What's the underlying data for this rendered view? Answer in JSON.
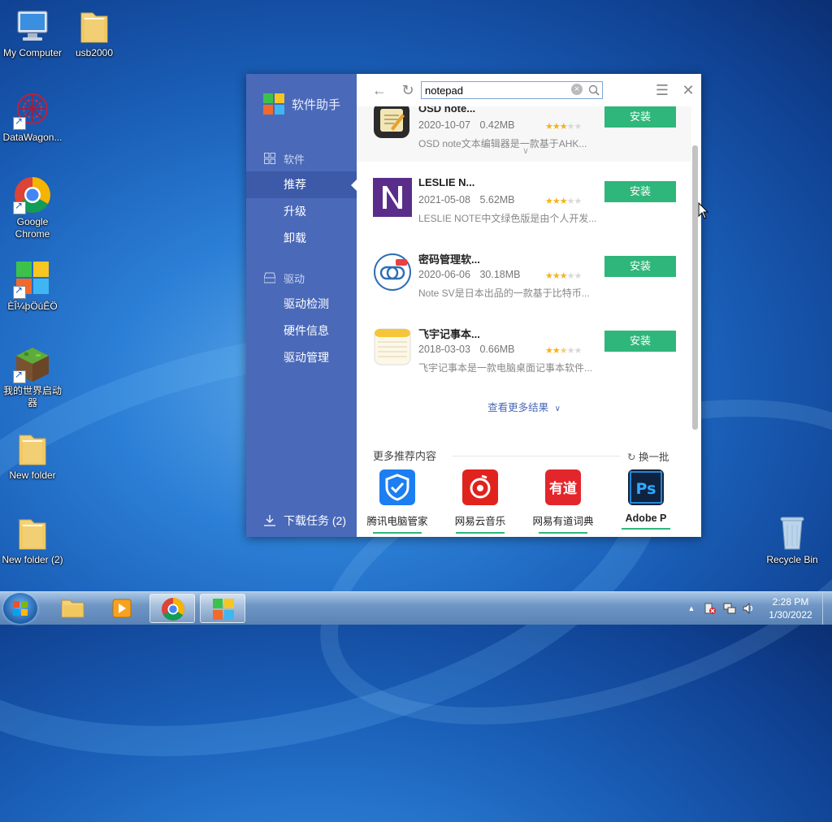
{
  "desktop": {
    "icons": [
      {
        "label": "My Computer"
      },
      {
        "label": "usb2000"
      },
      {
        "label": "DataWagon..."
      },
      {
        "label": "Google Chrome"
      },
      {
        "label": "ÈÎ¼þÖúÊÖ"
      },
      {
        "label": "我的世界启动器"
      },
      {
        "label": "New folder"
      },
      {
        "label": "New folder (2)"
      },
      {
        "label": "Recycle Bin"
      }
    ]
  },
  "app": {
    "title": "软件助手",
    "sidebar": {
      "section_software": "软件",
      "nav_software": [
        "推荐",
        "升级",
        "卸载"
      ],
      "section_driver": "驱动",
      "nav_driver": [
        "驱动检测",
        "硬件信息",
        "驱动管理"
      ],
      "download_tasks": "下载任务 (2)"
    },
    "search": {
      "value": "notepad",
      "placeholder": ""
    },
    "results": [
      {
        "name": "OSD note...",
        "date": "2020-10-07",
        "size": "0.42MB",
        "rating": 3,
        "desc": "OSD note文本编辑器是一款基于AHK...",
        "install_label": "安装"
      },
      {
        "name": "LESLIE N...",
        "date": "2021-05-08",
        "size": "5.62MB",
        "rating": 3,
        "desc": "LESLIE NOTE中文绿色版是由个人开发...",
        "install_label": "安装"
      },
      {
        "name": "密码管理软...",
        "date": "2020-06-06",
        "size": "30.18MB",
        "rating": 3,
        "desc": "Note SV是日本出品的一款基于比特币...",
        "install_label": "安装"
      },
      {
        "name": "飞宇记事本...",
        "date": "2018-03-03",
        "size": "0.66MB",
        "rating": 2.5,
        "desc": "飞宇记事本是一款电脑桌面记事本软件...",
        "install_label": "安装"
      }
    ],
    "more_results": "查看更多结果",
    "recommend": {
      "title": "更多推荐内容",
      "refresh": "换一批",
      "items": [
        {
          "name": "腾讯电脑管家",
          "color": "#1c7ef0"
        },
        {
          "name": "网易云音乐",
          "color": "#e0231c"
        },
        {
          "name": "网易有道词典",
          "color": "#e3262c"
        },
        {
          "name": "Adobe P",
          "color": "#0f2340"
        }
      ]
    },
    "colors": {
      "sidebar": "#4a69b8",
      "install": "#2fb67a"
    }
  },
  "taskbar": {
    "time": "2:28 PM",
    "date": "1/30/2022"
  }
}
